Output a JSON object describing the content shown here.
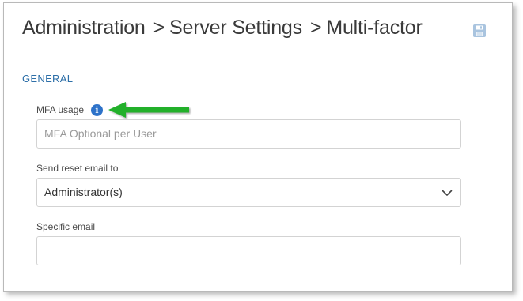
{
  "header": {
    "crumbs": [
      "Administration",
      "Server Settings",
      "Multi-factor"
    ],
    "separator": ">",
    "save_icon": "save-icon"
  },
  "section": {
    "title": "GENERAL"
  },
  "fields": {
    "mfa_usage": {
      "label": "MFA usage",
      "info_icon": "info-icon",
      "placeholder": "MFA Optional per User"
    },
    "reset_email": {
      "label": "Send reset email to",
      "value": "Administrator(s)",
      "chevron_icon": "chevron-down-icon"
    },
    "specific_email": {
      "label": "Specific email",
      "value": ""
    }
  },
  "annotation": {
    "arrow_icon": "green-arrow-left-icon",
    "arrow_color": "#22b02a"
  },
  "colors": {
    "section_title": "#2d6fa8",
    "info_icon": "#2d72c9",
    "save_icon": "#a9c4df"
  }
}
